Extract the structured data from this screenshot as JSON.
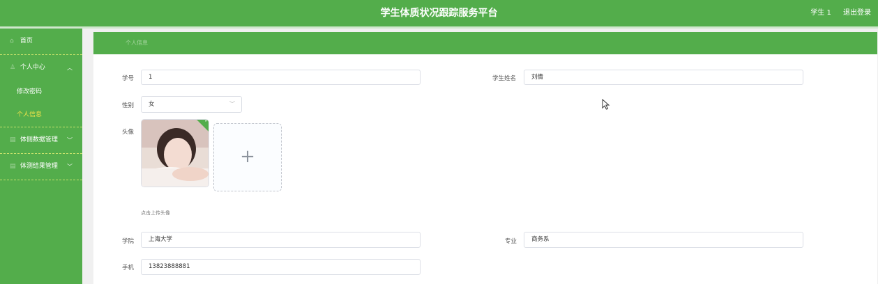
{
  "header": {
    "title": "学生体质状况跟踪服务平台",
    "user": "学生 1",
    "logout": "退出登录"
  },
  "sidebar": {
    "home": "首页",
    "personal_center": "个人中心",
    "change_password": "修改密码",
    "personal_info": "个人信息",
    "physical_data": "体侧数据管理",
    "physical_results": "体测结果管理"
  },
  "breadcrumb": "个人信息",
  "form": {
    "student_id_label": "学号",
    "student_id": "1",
    "student_name_label": "学生姓名",
    "student_name": "刘倩",
    "gender_label": "性别",
    "gender": "女",
    "avatar_label": "头像",
    "upload_hint": "点击上传头像",
    "college_label": "学院",
    "college": "上海大学",
    "major_label": "专业",
    "major": "商务系",
    "phone_label": "手机",
    "phone": "13823888881"
  },
  "colors": {
    "primary": "#53ad4b",
    "active_menu": "#f2e34a"
  },
  "icons": {
    "home": "home-icon",
    "user": "user-icon",
    "data": "data-icon",
    "result": "result-icon",
    "upload": "plus-icon",
    "success": "check-icon"
  }
}
